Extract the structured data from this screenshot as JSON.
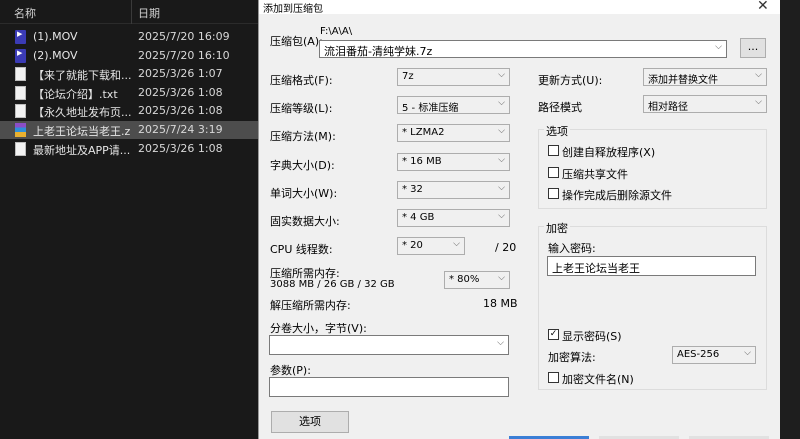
{
  "explorer": {
    "col_name": "名称",
    "col_date": "日期",
    "files": [
      {
        "name": "(1).MOV",
        "date": "2025/7/20 16:09",
        "icon": "mov-file-icon"
      },
      {
        "name": "(2).MOV",
        "date": "2025/7/20 16:10",
        "icon": "mov-file-icon"
      },
      {
        "name": "【来了就能下载和...",
        "date": "2025/3/26 1:07",
        "icon": "text-file-icon"
      },
      {
        "name": "【论坛介绍】.txt",
        "date": "2025/3/26 1:08",
        "icon": "text-file-icon"
      },
      {
        "name": "【永久地址发布页...",
        "date": "2025/3/26 1:08",
        "icon": "text-file-icon"
      },
      {
        "name": "上老王论坛当老王.z...",
        "date": "2025/7/24 3:19",
        "icon": "archive-file-icon",
        "selected": true
      },
      {
        "name": "最新地址及APP请...",
        "date": "2025/3/26 1:08",
        "icon": "text-file-icon"
      }
    ]
  },
  "dialog": {
    "title": "添加到压缩包",
    "close": "✕",
    "archive_label": "压缩包(A):",
    "archive_path": "F:\\A\\A\\",
    "archive_name": "流泪番茄-清纯学妹.7z",
    "browse": "...",
    "format_label": "压缩格式(F):",
    "format_value": "7z",
    "level_label": "压缩等级(L):",
    "level_value": "5 - 标准压缩",
    "method_label": "压缩方法(M):",
    "method_value": "* LZMA2",
    "dict_label": "字典大小(D):",
    "dict_value": "* 16 MB",
    "word_label": "单词大小(W):",
    "word_value": "* 32",
    "solid_label": "固实数据大小:",
    "solid_value": "* 4 GB",
    "threads_label": "CPU 线程数:",
    "threads_value": "* 20",
    "threads_total": "/ 20",
    "mem_comp_label": "压缩所需内存:",
    "mem_comp_detail": "3088 MB / 26 GB / 32 GB",
    "mem_percent": "* 80%",
    "mem_decomp_label": "解压缩所需内存:",
    "mem_decomp_value": "18 MB",
    "split_label": "分卷大小，字节(V):",
    "split_value": "",
    "params_label": "参数(P):",
    "params_value": "",
    "options_button": "选项",
    "update_label": "更新方式(U):",
    "update_value": "添加并替换文件",
    "path_label": "路径模式",
    "path_value": "相对路径",
    "options_group": "选项",
    "opt_sfx": "创建自释放程序(X)",
    "opt_shared": "压缩共享文件",
    "opt_delete": "操作完成后删除源文件",
    "enc_group": "加密",
    "enc_pw_label": "输入密码:",
    "enc_pw_value": "上老王论坛当老王",
    "enc_show": "显示密码(S)",
    "enc_method_label": "加密算法:",
    "enc_method_value": "AES-256",
    "enc_names": "加密文件名(N)",
    "checks": {
      "show": "✓"
    }
  }
}
